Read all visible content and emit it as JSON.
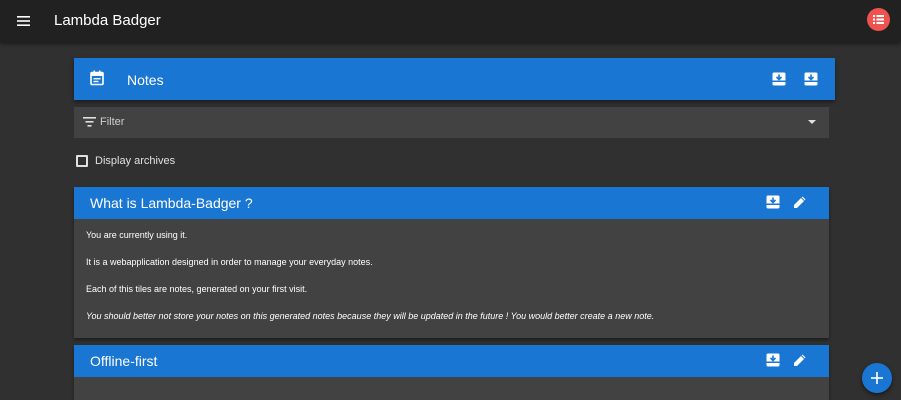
{
  "app": {
    "title": "Lambda Badger",
    "avatar_color": "#ef5350"
  },
  "icons": {
    "menu": "menu-icon",
    "avatar": "list-icon",
    "notes": "calendar-icon",
    "import": "import-icon",
    "export": "export-icon",
    "filter": "filter-icon",
    "archive": "archive-icon",
    "edit": "pencil-icon",
    "add": "plus-icon"
  },
  "notes_header": {
    "title": "Notes"
  },
  "filter": {
    "label": "Filter"
  },
  "archives": {
    "label": "Display archives",
    "checked": false
  },
  "cards": [
    {
      "title": "What is Lambda-Badger ?",
      "paragraphs": [
        "You are currently using it.",
        "It is a webapplication designed in order to manage your everyday notes.",
        "Each of this tiles are notes, generated on your first visit."
      ],
      "emphasis": "You should better not store your notes on this generated notes because they will be updated in the future ! You would better create a new note."
    },
    {
      "title": "Offline-first"
    }
  ],
  "colors": {
    "primary": "#1976d2",
    "background": "#303030",
    "surface": "#424242",
    "appbar": "#212121"
  }
}
